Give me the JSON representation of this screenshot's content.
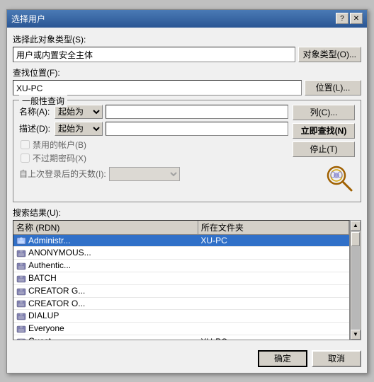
{
  "dialog": {
    "title": "选择用户",
    "title_icon": "👤",
    "help_btn": "?",
    "close_btn": "✕"
  },
  "object_type": {
    "label": "选择此对象类型(S):",
    "value": "用户或内置安全主体",
    "button": "对象类型(O)..."
  },
  "location": {
    "label": "查找位置(F):",
    "value": "XU-PC",
    "button": "位置(L)..."
  },
  "general_query": {
    "title": "一般性查询",
    "name_label": "名称(A):",
    "name_select": "起始为",
    "desc_label": "描述(D):",
    "desc_select": "起始为",
    "disabled_label": "禁用的帐户(B)",
    "expired_label": "不过期密码(X)",
    "days_label": "自上次登录后的天数(I):",
    "list_btn": "列(C)...",
    "search_btn": "立即查找(N)",
    "stop_btn": "停止(T)"
  },
  "results": {
    "label": "搜索结果(U):",
    "columns": [
      "名称 (RDN)",
      "所在文件夹"
    ],
    "rows": [
      {
        "name": "Administr...",
        "folder": "XU-PC",
        "selected": true
      },
      {
        "name": "ANONYMOUS...",
        "folder": "",
        "selected": false
      },
      {
        "name": "Authentic...",
        "folder": "",
        "selected": false
      },
      {
        "name": "BATCH",
        "folder": "",
        "selected": false
      },
      {
        "name": "CREATOR G...",
        "folder": "",
        "selected": false
      },
      {
        "name": "CREATOR O...",
        "folder": "",
        "selected": false
      },
      {
        "name": "DIALUP",
        "folder": "",
        "selected": false
      },
      {
        "name": "Everyone",
        "folder": "",
        "selected": false
      },
      {
        "name": "Guest",
        "folder": "XU-PC",
        "selected": false
      }
    ]
  },
  "footer": {
    "ok": "确定",
    "cancel": "取消"
  }
}
